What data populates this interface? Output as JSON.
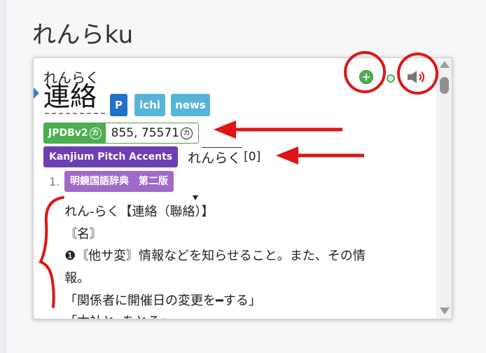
{
  "page": {
    "heading": "れんらku"
  },
  "entry": {
    "reading": "れんらく",
    "kanji": "連絡",
    "tags": [
      "P",
      "ichi",
      "news"
    ]
  },
  "frequency": {
    "label": "JPDBv2",
    "label_mark": "カ",
    "value": "855, 75571",
    "value_mark": "カ"
  },
  "pitch": {
    "label": "Kanjium Pitch Accents",
    "reading": "れんらく",
    "value": "[0]"
  },
  "glossary": {
    "number": "1.",
    "dictionary": "明鏡国語辞典　第二版",
    "lines": [
      "れん-らく【連絡（聯絡）】",
      "〘名〙",
      "❶〘他サ変〙情報などを知らせること。また、その情",
      "報。",
      "「関係者に開催日の変更を━する」",
      "「本社と━をとる」"
    ]
  },
  "icons": {
    "add": "add-note-icon",
    "audio": "play-audio-icon"
  },
  "annotation_color": "#e01515"
}
